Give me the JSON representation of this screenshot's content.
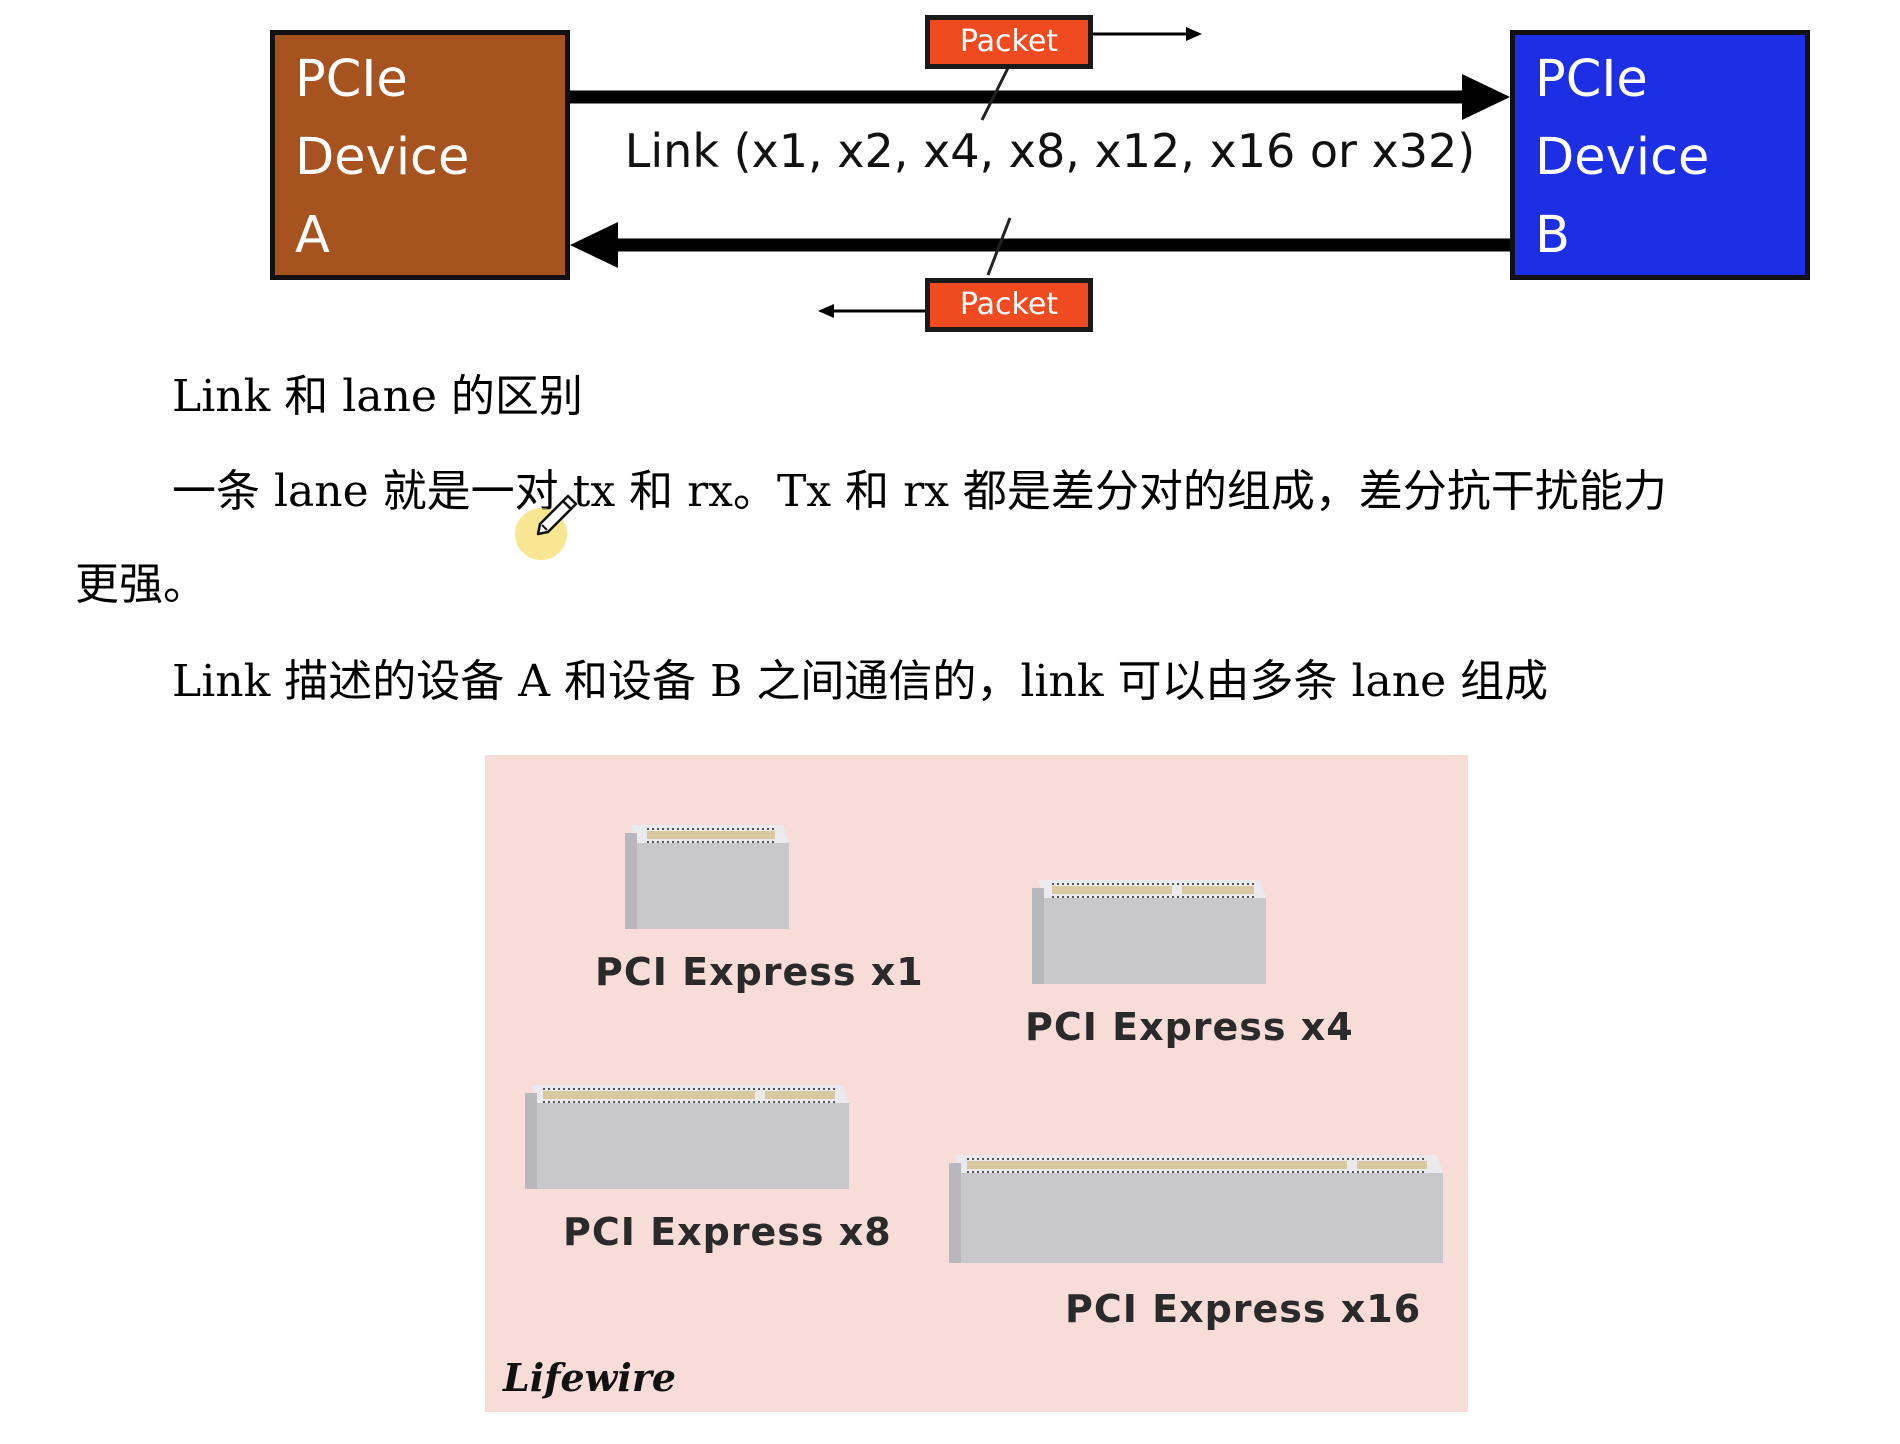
{
  "diagram": {
    "device_a": [
      "PCIe",
      "Device",
      "A"
    ],
    "device_b": [
      "PCIe",
      "Device",
      "B"
    ],
    "link_label": "Link (x1, x2, x4, x8, x12, x16 or x32)",
    "packet_top": "Packet",
    "packet_bottom": "Packet",
    "colors": {
      "device_a": "#a6531f",
      "device_b": "#1c2fe4",
      "packet": "#ef4a20"
    }
  },
  "text": {
    "heading": "Link 和 lane 的区别",
    "lane_line1": "一条 lane 就是一对 tx 和 rx。Tx 和 rx 都是差分对的组成，差分抗干扰能力",
    "lane_line2": "更强。",
    "link_line": "Link 描述的设备 A 和设备 B 之间通信的，link 可以由多条 lane 组成"
  },
  "slots": {
    "x1": "PCI Express x1",
    "x4": "PCI Express x4",
    "x8": "PCI Express x8",
    "x16": "PCI Express x16",
    "brand": "Lifewire"
  }
}
